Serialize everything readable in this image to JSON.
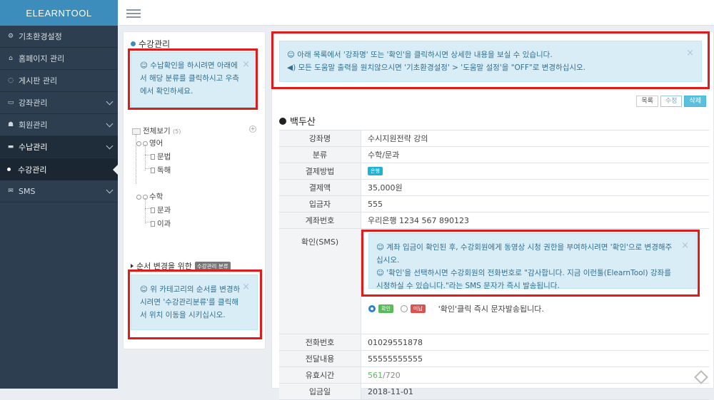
{
  "app": {
    "title": "ELEARNTOOL"
  },
  "sidebar": {
    "items": [
      {
        "label": "기초환경설정",
        "icon": "cogs-icon",
        "glyph": "⚙",
        "chevron": false
      },
      {
        "label": "홈페이지 관리",
        "icon": "home-icon",
        "glyph": "⌂",
        "chevron": false
      },
      {
        "label": "게시판 관리",
        "icon": "comment-icon",
        "glyph": "◌",
        "chevron": false
      },
      {
        "label": "강좌관리",
        "icon": "monitor-icon",
        "glyph": "▭",
        "chevron": true
      },
      {
        "label": "회원관리",
        "icon": "users-icon",
        "glyph": "☗",
        "chevron": true
      },
      {
        "label": "수납관리",
        "icon": "card-icon",
        "glyph": "▬",
        "chevron": true
      }
    ],
    "active_sub": "수강관리",
    "sms": {
      "label": "SMS",
      "icon": "envelope-icon",
      "glyph": "✉"
    }
  },
  "left_panel": {
    "title": "수강관리",
    "info1": "☺ 수납확인을 하시려면 아래에서 해당 분류를 클릭하시고 우측에서 확인하세요.",
    "tree": {
      "root": "전체보기",
      "root_count": "(5)",
      "groups": [
        {
          "label": "영어",
          "children": [
            "문법",
            "독해"
          ]
        },
        {
          "label": "수학",
          "children": [
            "문과",
            "이과"
          ]
        }
      ]
    },
    "order_label": "순서 변경을 위한",
    "order_badge": "수강관리 분류",
    "info2": "☺ 위 카테고리의 순서를 변경하시려면 '수강관리분류'를 클릭해서 위치 이동을 시키십시오."
  },
  "main": {
    "info_line1": "☺ 아래 목록에서 '강좌명' 또는 '확인'을 클릭하시면 상세한 내용을 보실 수 있습니다.",
    "info_line2": "◀) 모든 도움말 출력을 원치않으시면 '기초환경설정' > '도움말 설정'을 \"OFF\"로 변경하십시오.",
    "buttons": {
      "list": "목록",
      "edit": "수정",
      "delete": "삭제"
    },
    "person": "백두산",
    "rows": {
      "course": {
        "label": "강좌명",
        "value": "수시지원전략 강의"
      },
      "category": {
        "label": "분류",
        "value": "수학/문과"
      },
      "payment": {
        "label": "결제방법",
        "value": "은행"
      },
      "amount": {
        "label": "결제액",
        "value": "35,000원"
      },
      "depositor": {
        "label": "입금자",
        "value": "555"
      },
      "account": {
        "label": "계좌번호",
        "value": "우리은행 1234 567 890123"
      },
      "confirm": {
        "label": "확인(SMS)",
        "info_line1": "☺ 계좌 입금이 확인된 후, 수강회원에게 동영상 시청 권한을 부여하시려면 '확인'으로 변경해주십시오.",
        "info_line2": "☺ '확인'을 선택하시면 수강회원의 전화번호로 \"감사합니다. 지금 이런툴(ElearnTool) 강좌를 시청하실 수 있습니다.\"라는 SMS 문자가 즉시 발송됩니다.",
        "opt_confirm": "확인",
        "opt_pending": "미납",
        "note": "'확인'클릭 즉시 문자발송됩니다."
      },
      "phone": {
        "label": "전화번호",
        "value": "01029551878"
      },
      "content": {
        "label": "전달내용",
        "value": "55555555555"
      },
      "valid": {
        "label": "유효시간",
        "used": "561",
        "total": "/720"
      },
      "date": {
        "label": "입금일",
        "value": "2018-11-01"
      }
    }
  }
}
